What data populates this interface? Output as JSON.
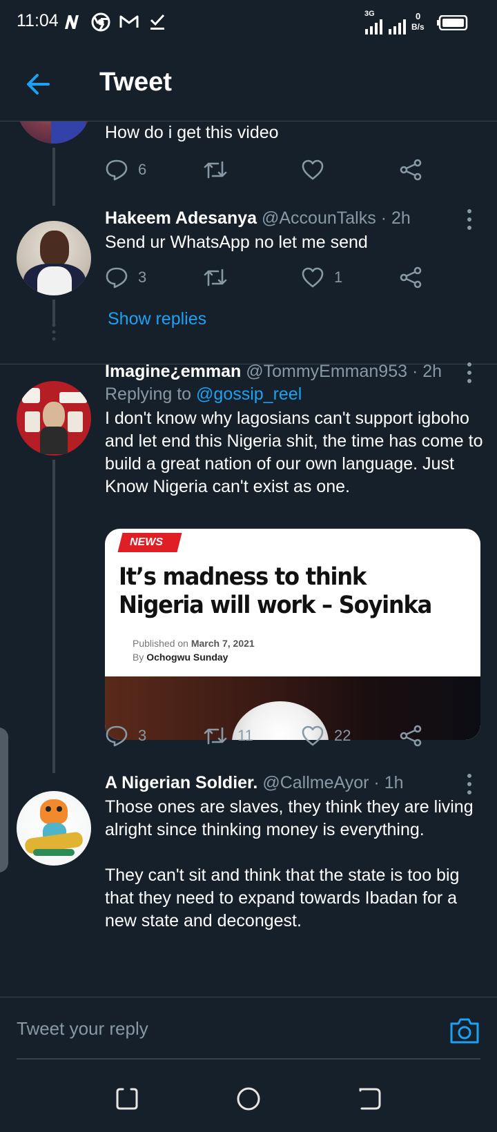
{
  "status_bar": {
    "time": "11:04",
    "network_label": "3G",
    "speed_value": "0",
    "speed_unit": "B/s",
    "icons": [
      "n-app-icon",
      "chrome-icon",
      "gmail-icon",
      "check-download-icon",
      "signal-icon",
      "signal-icon",
      "battery-icon"
    ]
  },
  "app_bar": {
    "title": "Tweet",
    "back_icon": "arrow-left-icon"
  },
  "tweets": [
    {
      "text": "How do i get this video",
      "reply_count": "6",
      "retweet_count": "",
      "like_count": ""
    },
    {
      "name": "Hakeem Adesanya",
      "handle": "@AccounTalks",
      "dot": "·",
      "time": "2h",
      "text": "Send ur WhatsApp no let me send",
      "reply_count": "3",
      "retweet_count": "",
      "like_count": "1"
    },
    {
      "name": "Imagine¿emman",
      "handle": "@TommyEmman953",
      "dot": "·",
      "time": "2h",
      "replying_prefix": "Replying to",
      "replying_to": "@gossip_reel",
      "text": "I don't know why lagosians can't support igboho and let end this Nigeria shit, the time has come to build a great nation of our own language. Just Know Nigeria can't exist as one.",
      "card": {
        "badge": "NEWS",
        "headline": "It’s madness to think Nigeria will work – Soyinka",
        "published_prefix": "Published on",
        "published_date": "March 7, 2021",
        "by_prefix": "By",
        "author": "Ochogwu Sunday"
      },
      "reply_count": "3",
      "retweet_count": "11",
      "like_count": "22"
    },
    {
      "name": "A Nigerian Soldier.",
      "handle": "@CallmeAyor",
      "dot": "·",
      "time": "1h",
      "text_p1": "Those ones are slaves, they think they are living alright since thinking money is everything.",
      "text_p2": "They can't sit and think that the state is too big that they need to expand towards Ibadan for a new state and decongest."
    }
  ],
  "show_replies": "Show replies",
  "reply_bar": {
    "placeholder": "Tweet your reply",
    "camera_icon": "camera-icon"
  },
  "nav_bar": {
    "icons": [
      "recents-icon",
      "home-icon",
      "back-icon"
    ]
  },
  "colors": {
    "background": "#15202b",
    "accent": "#1da1f2",
    "muted": "#8899a6",
    "border": "#38444d"
  }
}
